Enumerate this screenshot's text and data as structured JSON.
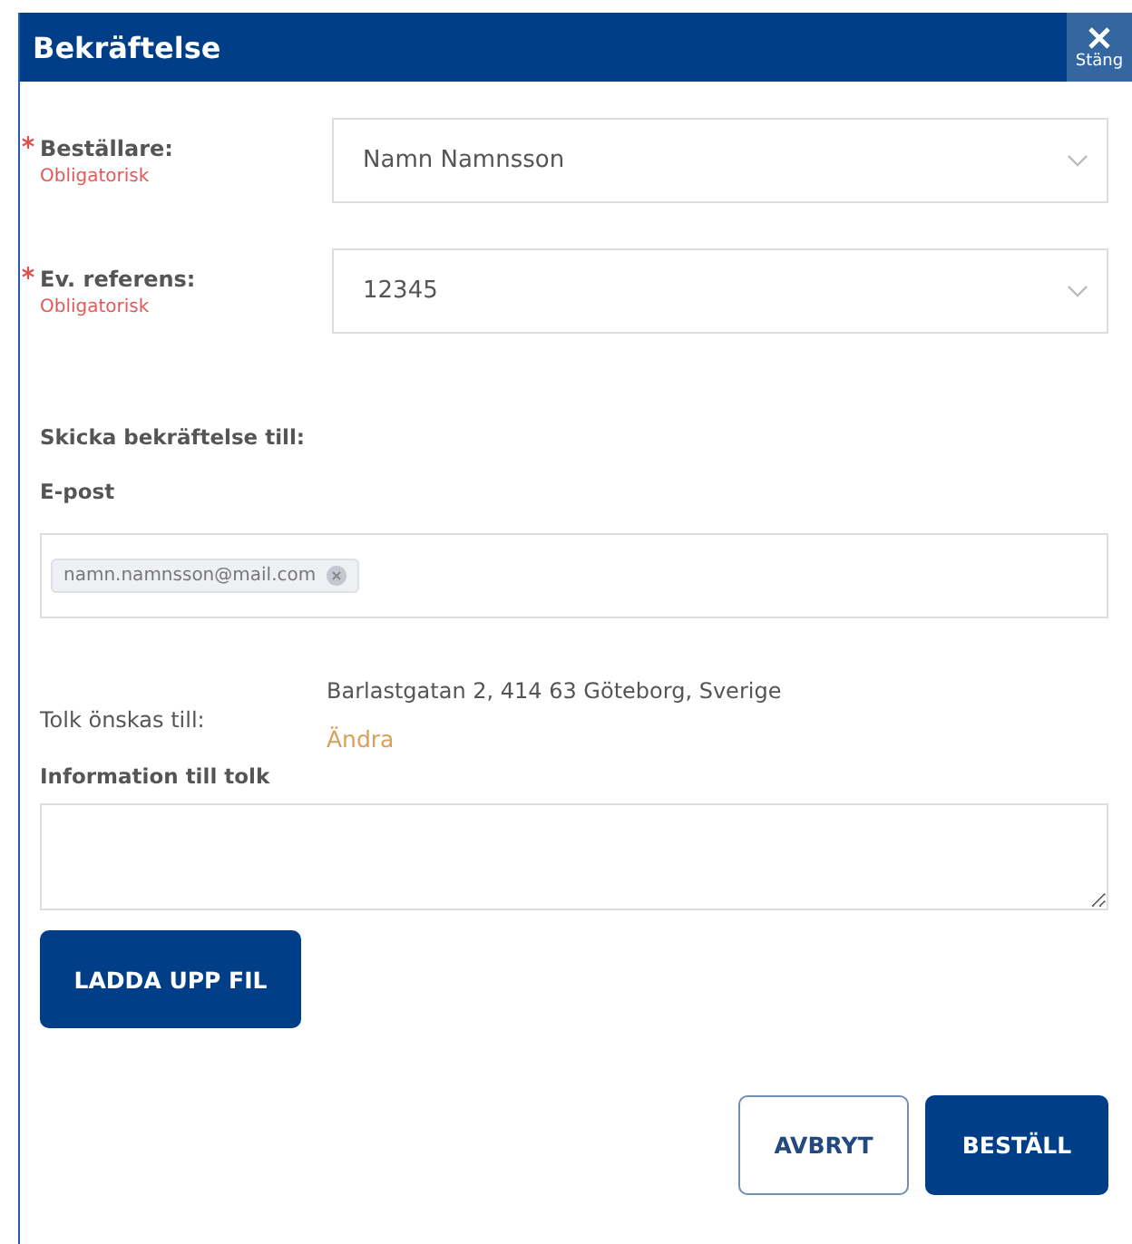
{
  "dialog": {
    "title": "Bekräftelse",
    "close_label": "Stäng"
  },
  "selects": [
    {
      "label": "Beställare:",
      "required": true,
      "hint": "Obligatorisk",
      "value": "Namn Namnsson"
    },
    {
      "label": "Ev. referens:",
      "required": true,
      "hint": "Obligatorisk",
      "value": "12345"
    }
  ],
  "confirmation": {
    "heading": "Skicka bekräftelse till:",
    "email_label": "E-post",
    "emails": [
      "namn.namnsson@mail.com"
    ]
  },
  "interpreter": {
    "label": "Tolk önskas till:",
    "address": "Barlastgatan 2, 414 63 Göteborg, Sverige",
    "change_link": "Ändra"
  },
  "info": {
    "label": "Information till tolk"
  },
  "upload_button": "LADDA UPP FIL",
  "buttons": [
    {
      "label": "AVBRYT",
      "kind": "secondary"
    },
    {
      "label": "BESTÄLL",
      "kind": "primary"
    }
  ]
}
